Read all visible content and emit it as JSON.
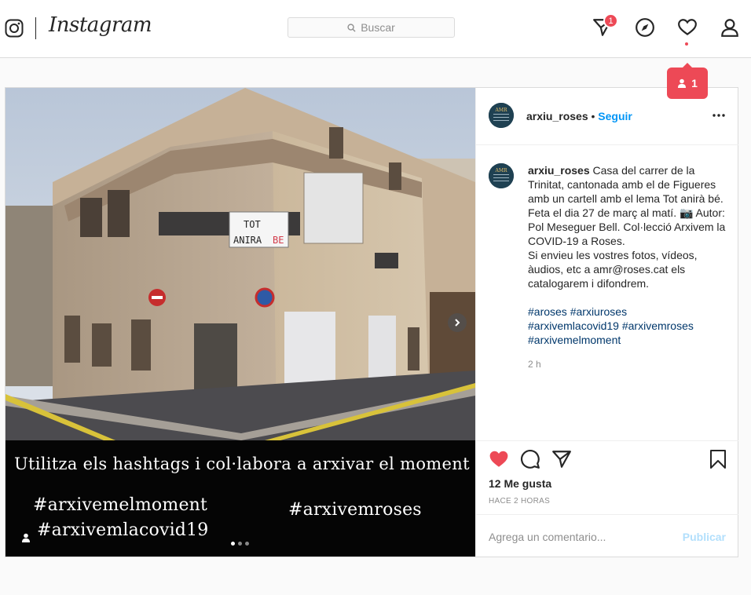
{
  "header": {
    "logo_text": "Instagram",
    "search_placeholder": "Buscar",
    "direct_badge": "1",
    "activity_tooltip_count": "1"
  },
  "post": {
    "username": "arxiu_roses",
    "separator": "•",
    "follow_label": "Seguir",
    "image_banner": {
      "headline": "Utilitza els hashtags i col·labora a arxivar el moment",
      "tags": [
        "#arxivemelmoment",
        "#arxivemroses",
        "#arxivemlacovid19"
      ]
    },
    "sign_text": "TOT ANIRÀ BÉ",
    "caption": {
      "username": "arxiu_roses",
      "text_lines": [
        "Casa del carrer de la Trinitat, cantonada amb el de Figueres amb un cartell amb el lema Tot anirà bé. Feta el dia 27 de març al matí. 📷 Autor: Pol Meseguer Bell. Col·lecció Arxivem la COVID-19 a Roses.",
        "Si envieu les vostres fotos, vídeos, àudios, etc a amr@roses.cat els catalogarem i difondrem."
      ],
      "hashtags": [
        "#aroses",
        "#arxiuroses",
        "#arxivemlacovid19",
        "#arxivemroses",
        "#arxivemelmoment"
      ]
    },
    "comment_time": "2 h",
    "likes": "12 Me gusta",
    "posted_ago": "HACE 2 HORAS",
    "comment_placeholder": "Agrega un comentario...",
    "publish_label": "Publicar",
    "avatar_text": "ARXIU MUNICIPAL DE ROSES"
  },
  "colors": {
    "like_red": "#ed4956",
    "link_blue": "#0095f6",
    "hashtag_blue": "#00376b"
  }
}
